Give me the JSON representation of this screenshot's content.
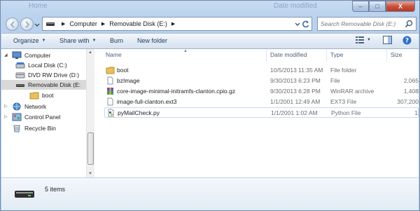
{
  "window": {
    "bg_title_left": "Home",
    "bg_title_right": "Date modified",
    "caption": {
      "minimize": "–",
      "maximize": "□",
      "close": "X"
    }
  },
  "address": {
    "crumbs": [
      "Computer",
      "Removable Disk (E:)"
    ]
  },
  "search": {
    "placeholder": "Search Removable Disk (E:)"
  },
  "toolbar": {
    "organize": "Organize",
    "share_with": "Share with",
    "burn": "Burn",
    "new_folder": "New folder"
  },
  "nav": {
    "items": [
      {
        "label": "Computer",
        "icon": "computer-icon"
      },
      {
        "label": "Local Disk (C:)",
        "icon": "hard-drive-icon"
      },
      {
        "label": "DVD RW Drive (D:)",
        "icon": "dvd-drive-icon"
      },
      {
        "label": "Removable Disk (E:",
        "icon": "removable-disk-icon"
      },
      {
        "label": "boot",
        "icon": "folder-icon"
      },
      {
        "label": "Network",
        "icon": "network-icon"
      },
      {
        "label": "Control Panel",
        "icon": "control-panel-icon"
      },
      {
        "label": "Recycle Bin",
        "icon": "recycle-bin-icon"
      }
    ]
  },
  "files": {
    "columns": [
      "Name",
      "Date modified",
      "Type",
      "Size"
    ],
    "rows": [
      {
        "name": "boot",
        "date": "10/5/2013 11:35 AM",
        "type": "File folder",
        "size": "",
        "icon": "folder-icon"
      },
      {
        "name": "bzImage",
        "date": "9/30/2013 6:23 PM",
        "type": "File",
        "size": "2,065",
        "icon": "file-icon"
      },
      {
        "name": "core-image-minimal-initramfs-clanton.cpio.gz",
        "date": "9/30/2013 6:28 PM",
        "type": "WinRAR archive",
        "size": "1,408",
        "icon": "winrar-icon"
      },
      {
        "name": "image-full-clanton.ext3",
        "date": "1/1/2001 12:49 AM",
        "type": "EXT3 File",
        "size": "307,200",
        "icon": "file-icon"
      },
      {
        "name": "pyMailCheck.py",
        "date": "1/1/2001 1:02 AM",
        "type": "Python File",
        "size": "1",
        "icon": "python-file-icon"
      }
    ]
  },
  "details": {
    "item_count": "5 items"
  }
}
